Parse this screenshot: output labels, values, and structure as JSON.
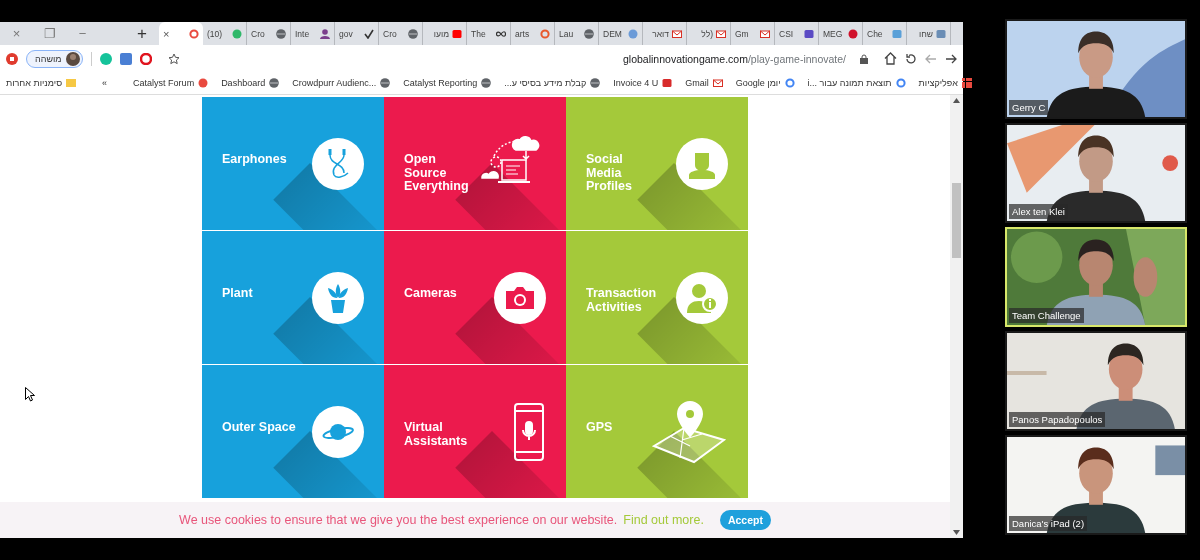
{
  "browser": {
    "window_controls": [
      "×",
      "❐",
      "−"
    ],
    "new_tab": "+",
    "tab_close": "×",
    "tabs": [
      {
        "selected": true,
        "kind": "ring",
        "color": "#e94a3f"
      },
      {
        "title": "(10)",
        "selected": false,
        "kind": "dot",
        "color": "#2fb86a"
      },
      {
        "title": "Cro",
        "selected": false,
        "kind": "globe",
        "color": "#5f6368"
      },
      {
        "title": "Inte",
        "selected": false,
        "kind": "person",
        "color": "#7b3f8c"
      },
      {
        "title": "gov",
        "selected": false,
        "kind": "check",
        "color": "#333333"
      },
      {
        "title": "Cro",
        "selected": false,
        "kind": "globe",
        "color": "#5f6368"
      },
      {
        "title": "מועו",
        "selected": false,
        "kind": "square",
        "color": "#ff0000"
      },
      {
        "title": "The",
        "selected": false,
        "kind": "infinity",
        "color": "#333333"
      },
      {
        "title": "arts",
        "selected": false,
        "kind": "ring",
        "color": "#e8592c"
      },
      {
        "title": "Lau",
        "selected": false,
        "kind": "globe",
        "color": "#5f6368"
      },
      {
        "title": "DEM",
        "selected": false,
        "kind": "dot",
        "color": "#6b9bd8"
      },
      {
        "title": "דואר",
        "selected": false,
        "kind": "mail",
        "color": "#d93025"
      },
      {
        "title": "(לל",
        "selected": false,
        "kind": "mail",
        "color": "#d93025"
      },
      {
        "title": "Gm",
        "selected": false,
        "kind": "mail",
        "color": "#d93025"
      },
      {
        "title": "CSI",
        "selected": false,
        "kind": "square",
        "color": "#5b4bc4"
      },
      {
        "title": "MEG",
        "selected": false,
        "kind": "dot",
        "color": "#d0112b"
      },
      {
        "title": "Che",
        "selected": false,
        "kind": "square",
        "color": "#5aa0d8"
      },
      {
        "title": "שחו",
        "selected": false,
        "kind": "square",
        "color": "#6a8db5"
      }
    ],
    "profile": "מושהה",
    "url_host": "globalinnovationgame.com",
    "url_path": "/play-game-innovate/",
    "other_bookmarks": "סימניות אחרות",
    "more_bookmarks": "«",
    "bookmarks": [
      {
        "label": "Catalyst Forum",
        "kind": "dot",
        "color": "#e94a3f"
      },
      {
        "label": "Dashboard",
        "kind": "globe",
        "color": "#5f6368"
      },
      {
        "label": "Crowdpurr Audienc...",
        "kind": "globe",
        "color": "#5f6368"
      },
      {
        "label": "Catalyst Reporting",
        "kind": "globe",
        "color": "#5f6368"
      },
      {
        "label": "קבלת מידע בסיסי ע...",
        "kind": "globe",
        "color": "#5f6368"
      },
      {
        "label": "Invoice 4 U",
        "kind": "square",
        "color": "#d82b2b"
      },
      {
        "label": "Gmail",
        "kind": "mail",
        "color": "#d93025"
      },
      {
        "label": "יומן Google",
        "kind": "ring",
        "color": "#4285f4"
      },
      {
        "label": "תוצאת תמונה עבור ...i",
        "kind": "ring",
        "color": "#4285f4"
      },
      {
        "label": "אפליקציות",
        "kind": "apps",
        "color": "#e94a3f"
      }
    ]
  },
  "page": {
    "tiles": [
      {
        "label": "Earphones",
        "kind": "earphones",
        "color": "#17a1dc"
      },
      {
        "label": "Open\nSource\nEverything",
        "kind": "cloud",
        "color": "#ec1a4d"
      },
      {
        "label": "Social\nMedia\nProfiles",
        "kind": "profile",
        "color": "#a4c93a"
      },
      {
        "label": "Plant",
        "kind": "plant",
        "color": "#17a1dc"
      },
      {
        "label": "Cameras",
        "kind": "camera",
        "color": "#ec1a4d"
      },
      {
        "label": "Transaction\nActivities",
        "kind": "info",
        "color": "#a4c93a"
      },
      {
        "label": "Outer Space",
        "kind": "planet",
        "color": "#17a1dc"
      },
      {
        "label": "Virtual\nAssistants",
        "kind": "phone",
        "color": "#ec1a4d"
      },
      {
        "label": "GPS",
        "kind": "map",
        "color": "#a4c93a"
      }
    ],
    "cookie": {
      "text": "We use cookies to ensure that we give you the best experience on our website.",
      "link": "Find out more.",
      "button": "Accept"
    }
  },
  "participants": [
    {
      "name": "Gerry C",
      "active": false
    },
    {
      "name": "Alex ten Klei",
      "active": false
    },
    {
      "name": "Team Challenge",
      "active": true
    },
    {
      "name": "Panos Papadopoulos",
      "active": false
    },
    {
      "name": "Danica's iPad (2)",
      "active": false
    }
  ]
}
